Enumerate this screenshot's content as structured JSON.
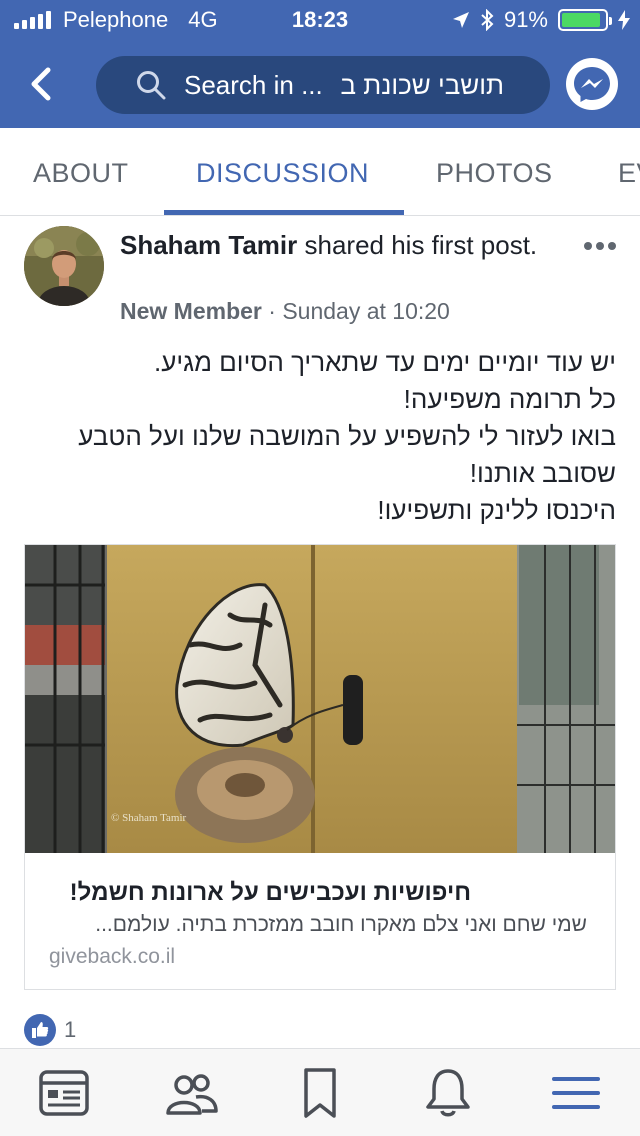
{
  "status_bar": {
    "carrier": "Pelephone",
    "network": "4G",
    "time": "18:23",
    "battery_percent": "91%",
    "battery_level": 0.91
  },
  "nav": {
    "search_text": "Search in ...",
    "search_group_name": "תושבי שכונת ב"
  },
  "tabs": [
    "ABOUT",
    "DISCUSSION",
    "PHOTOS",
    "EV"
  ],
  "active_tab": "DISCUSSION",
  "post": {
    "author": "Shaham Tamir",
    "action": "shared his first post.",
    "badge": "New Member",
    "separator": "·",
    "timestamp": "Sunday at 10:20",
    "body_lines": [
      "יש עוד יומיים ימים עד שתאריך הסיום מגיע.",
      "כל תרומה משפיעה!",
      "בואו לעזור לי להשפיע על המושבה שלנו ועל הטבע",
      "שסובב אותנו!",
      "היכנסו ללינק ותשפיעו!"
    ],
    "link": {
      "title": "חיפושיות ועכבישים על ארונות חשמל!",
      "description": "שמי שחם ואני צלם מאקרו חובב ממזכרת בתיה. עולמם...",
      "domain": "giveback.co.il",
      "image_watermark": "© Shaham Tamir"
    },
    "likes": "1"
  },
  "bottom_nav": [
    "news-feed",
    "groups",
    "saved",
    "notifications",
    "menu"
  ],
  "colors": {
    "brand": "#4267b2",
    "search_bg": "#29487d",
    "battery": "#4cd964"
  }
}
